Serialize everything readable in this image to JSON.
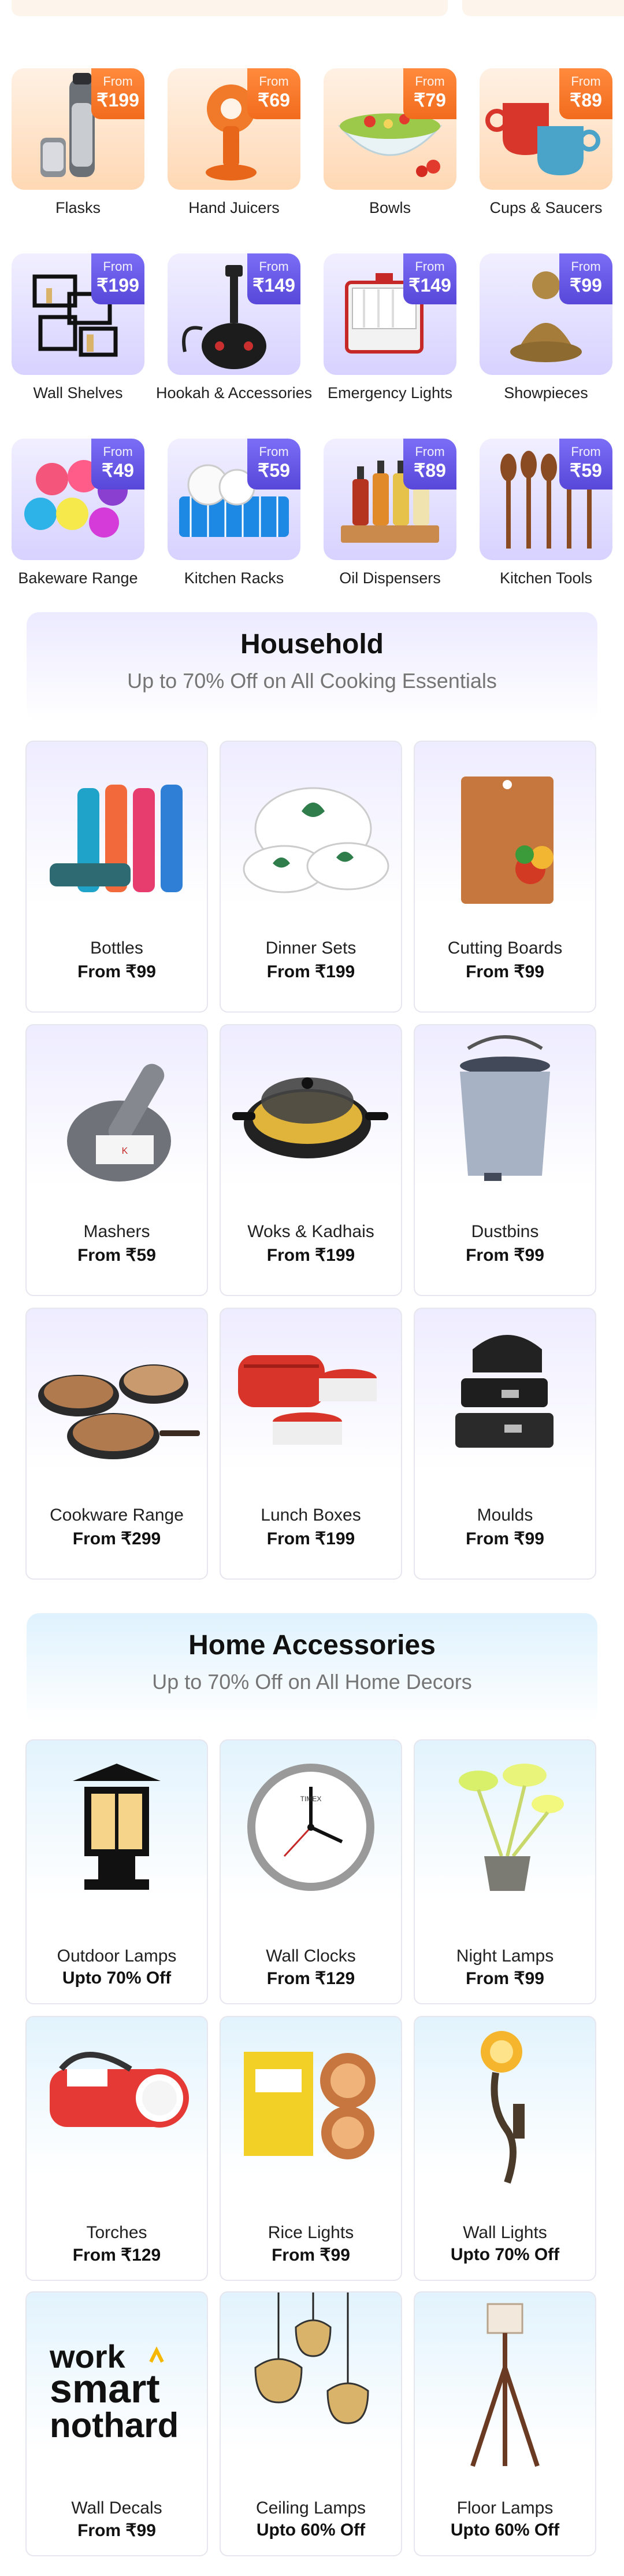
{
  "categories": [
    {
      "name": "Flasks",
      "from": "From",
      "price": "₹199",
      "icon": "flask-icon"
    },
    {
      "name": "Hand Juicers",
      "from": "From",
      "price": "₹69",
      "icon": "juicer-icon"
    },
    {
      "name": "Bowls",
      "from": "From",
      "price": "₹79",
      "icon": "bowl-icon"
    },
    {
      "name": "Cups & Saucers",
      "from": "From",
      "price": "₹89",
      "icon": "cups-icon"
    },
    {
      "name": "Wall Shelves",
      "from": "From",
      "price": "₹199",
      "icon": "shelf-icon"
    },
    {
      "name": "Hookah & Accessories",
      "from": "From",
      "price": "₹149",
      "icon": "hookah-icon"
    },
    {
      "name": "Emergency Lights",
      "from": "From",
      "price": "₹149",
      "icon": "emergency-light-icon"
    },
    {
      "name": "Showpieces",
      "from": "From",
      "price": "₹99",
      "icon": "buddha-icon"
    },
    {
      "name": "Bakeware Range",
      "from": "From",
      "price": "₹49",
      "icon": "bakeware-icon"
    },
    {
      "name": "Kitchen Racks",
      "from": "From",
      "price": "₹59",
      "icon": "rack-icon"
    },
    {
      "name": "Oil Dispensers",
      "from": "From",
      "price": "₹89",
      "icon": "oil-dispenser-icon"
    },
    {
      "name": "Kitchen Tools",
      "from": "From",
      "price": "₹59",
      "icon": "kitchen-tools-icon"
    }
  ],
  "household": {
    "title": "Household",
    "subtitle": "Up to 70% Off on All Cooking Essentials",
    "items": [
      {
        "name": "Bottles",
        "price": "From ₹99",
        "icon": "bottles-icon"
      },
      {
        "name": "Dinner Sets",
        "price": "From ₹199",
        "icon": "dinner-set-icon"
      },
      {
        "name": "Cutting Boards",
        "price": "From ₹99",
        "icon": "cutting-board-icon"
      },
      {
        "name": "Mashers",
        "price": "From ₹59",
        "icon": "masher-icon"
      },
      {
        "name": "Woks & Kadhais",
        "price": "From ₹199",
        "icon": "wok-icon"
      },
      {
        "name": "Dustbins",
        "price": "From ₹99",
        "icon": "dustbin-icon"
      },
      {
        "name": "Cookware Range",
        "price": "From ₹299",
        "icon": "cookware-icon"
      },
      {
        "name": "Lunch Boxes",
        "price": "From ₹199",
        "icon": "lunch-box-icon"
      },
      {
        "name": "Moulds",
        "price": "From ₹99",
        "icon": "mould-icon"
      }
    ]
  },
  "home_accessories": {
    "title": "Home Accessories",
    "subtitle": "Up to 70% Off on All Home Decors",
    "items": [
      {
        "name": "Outdoor Lamps",
        "price": "Upto 70% Off",
        "icon": "outdoor-lamp-icon"
      },
      {
        "name": "Wall Clocks",
        "price": "From ₹129",
        "icon": "wall-clock-icon",
        "brand": "TIMEX"
      },
      {
        "name": "Night Lamps",
        "price": "From ₹99",
        "icon": "night-lamp-icon"
      },
      {
        "name": "Torches",
        "price": "From ₹129",
        "icon": "torch-icon"
      },
      {
        "name": "Rice Lights",
        "price": "From ₹99",
        "icon": "rice-lights-icon"
      },
      {
        "name": "Wall Lights",
        "price": "Upto 70% Off",
        "icon": "wall-light-icon"
      },
      {
        "name": "Wall Decals",
        "price": "From ₹99",
        "icon": "wall-decal-icon",
        "decal_text": [
          "work",
          "smart",
          "nothard"
        ]
      },
      {
        "name": "Ceiling Lamps",
        "price": "Upto 60% Off",
        "icon": "ceiling-lamp-icon"
      },
      {
        "name": "Floor Lamps",
        "price": "Upto 60% Off",
        "icon": "floor-lamp-icon"
      }
    ]
  },
  "colors": {
    "orange_badge": "#f26b1d",
    "purple_badge": "#5847d9",
    "household_header": "#eceaff",
    "accessories_header": "#dff2fd"
  }
}
